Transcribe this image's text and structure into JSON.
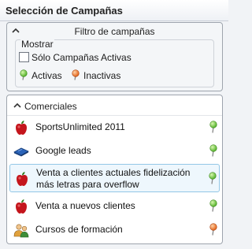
{
  "panel": {
    "title": "Selección de Campañas"
  },
  "filter": {
    "title": "Filtro de campañas",
    "group_label": "Mostrar",
    "checkbox_label": "Sólo Campañas Activas",
    "checkbox_checked": false,
    "legend": [
      {
        "label": "Activas",
        "icon": "green-pin-icon",
        "color": "#56b32c"
      },
      {
        "label": "Inactivas",
        "icon": "orange-pin-icon",
        "color": "#e2641c"
      }
    ]
  },
  "list": {
    "group_label": "Comerciales",
    "items": [
      {
        "label": "SportsUnlimited 2011",
        "icon": "apple-logo-icon",
        "status": "active"
      },
      {
        "label": "Google leads",
        "icon": "diamond-tile-icon",
        "status": "active"
      },
      {
        "label": "Venta a clientes actuales fidelización",
        "label2": "más letras para overflow",
        "icon": "apple-logo-icon",
        "status": "active",
        "selected": true
      },
      {
        "label": "Venta a nuevos clientes",
        "icon": "apple-logo-icon",
        "status": "active"
      },
      {
        "label": "Cursos de formación",
        "icon": "people-icon",
        "status": "inactive"
      }
    ]
  },
  "colors": {
    "active": "#56b32c",
    "inactive": "#e2641c",
    "selected_border": "#93c7e6",
    "selected_bg": "#eef7fd"
  }
}
